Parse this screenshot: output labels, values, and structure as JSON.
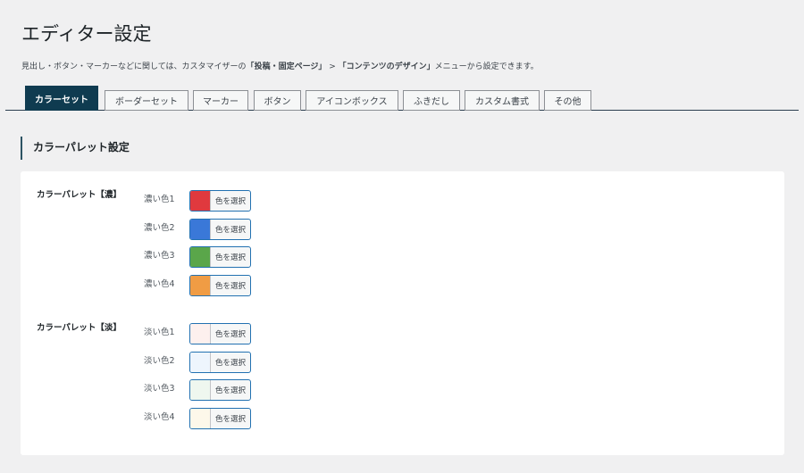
{
  "title": "エディター設定",
  "description": {
    "pre": "見出し・ボタン・マーカーなどに関しては、カスタマイザーの",
    "b1": "「投稿・固定ページ」",
    "mid": " > ",
    "b2": "「コンテンツのデザイン」",
    "post": "メニューから設定できます。"
  },
  "tabs": [
    {
      "label": "カラーセット",
      "active": true
    },
    {
      "label": "ボーダーセット"
    },
    {
      "label": "マーカー"
    },
    {
      "label": "ボタン"
    },
    {
      "label": "アイコンボックス"
    },
    {
      "label": "ふきだし"
    },
    {
      "label": "カスタム書式"
    },
    {
      "label": "その他"
    }
  ],
  "section_title": "カラーパレット設定",
  "picker_label": "色を選択",
  "groups": [
    {
      "label": "カラーパレット【濃】",
      "items": [
        {
          "label": "濃い色1",
          "color": "#e0393e"
        },
        {
          "label": "濃い色2",
          "color": "#3a78d8"
        },
        {
          "label": "濃い色3",
          "color": "#5aa64a"
        },
        {
          "label": "濃い色4",
          "color": "#f09c44"
        }
      ]
    },
    {
      "label": "カラーパレット【淡】",
      "items": [
        {
          "label": "淡い色1",
          "color": "#fdf0ee"
        },
        {
          "label": "淡い色2",
          "color": "#eef5fd"
        },
        {
          "label": "淡い色3",
          "color": "#eff7ef"
        },
        {
          "label": "淡い色4",
          "color": "#fdf8ea"
        }
      ]
    }
  ]
}
